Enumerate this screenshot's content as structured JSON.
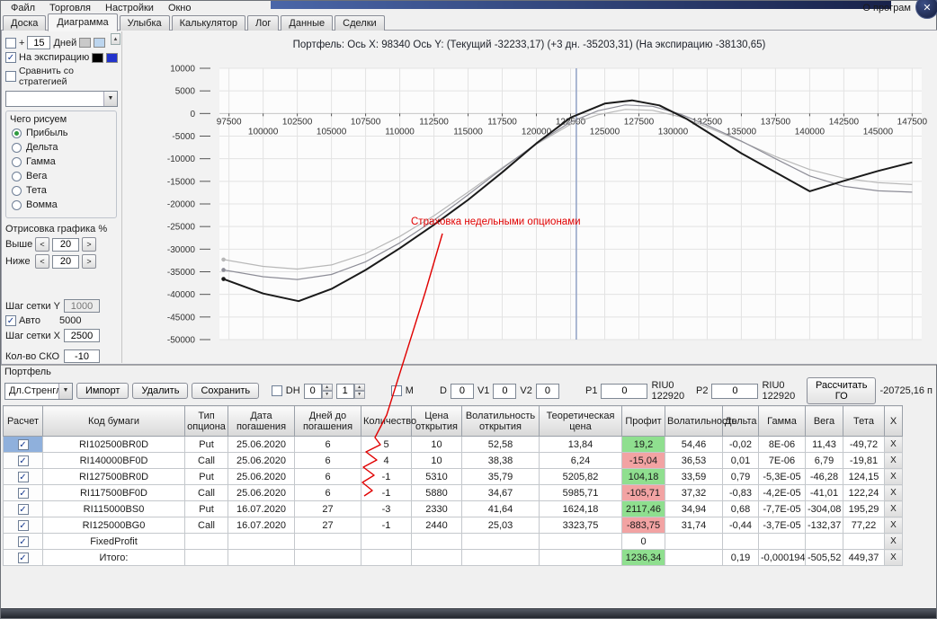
{
  "icons": {
    "check": "✓",
    "dropdown": "▼",
    "close": "✕",
    "scroll_up": "▲",
    "spin_up": "▲",
    "spin_down": "▼"
  },
  "window": {
    "about_label": "О програм"
  },
  "menubar": {
    "items": [
      "Файл",
      "Торговля",
      "Настройки",
      "Окно"
    ]
  },
  "tabs": {
    "items": [
      "Доска",
      "Диаграмма",
      "Улыбка",
      "Калькулятор",
      "Лог",
      "Данные",
      "Сделки"
    ],
    "active": "Диаграмма"
  },
  "sidebar": {
    "days_plus": "+",
    "days_value": "15",
    "days_label": "Дней",
    "legend_days_colors": [
      "#c9c9c9",
      "#bcd5ee"
    ],
    "exp_label": "На экспирацию",
    "legend_exp_colors": [
      "#000000",
      "#2233cc"
    ],
    "compare_label": "Сравнить со стратегией",
    "draw_title": "Чего рисуем",
    "draw_options": [
      "Прибыль",
      "Дельта",
      "Гамма",
      "Вега",
      "Тета",
      "Вомма"
    ],
    "draw_selected": "Прибыль",
    "render_title": "Отрисовка графика %",
    "above_label": "Выше",
    "above_value": "20",
    "below_label": "Ниже",
    "below_value": "20",
    "dec_label": "<",
    "inc_label": ">",
    "grid_y_label": "Шаг сетки Y",
    "grid_y_value": "1000",
    "auto_label": "Авто",
    "auto_extra": "5000",
    "grid_x_label": "Шаг сетки X",
    "grid_x_value": "2500",
    "sko_label": "Кол-во СКО",
    "sko_value": "-10"
  },
  "chart_data": {
    "type": "line",
    "title": "Портфель: Ось X: 98340 Ось Y:  (Текущий -32233,17)  (+3 дн. -35203,31)  (На экспирацию -38130,65)",
    "xlim": [
      96800,
      148200
    ],
    "ylim": [
      -50000,
      10000
    ],
    "x_ticks": [
      97500,
      100000,
      102500,
      105000,
      107500,
      110000,
      112500,
      115000,
      117500,
      120000,
      122500,
      125000,
      127500,
      130000,
      132500,
      135000,
      137500,
      140000,
      142500,
      145000,
      147500
    ],
    "y_ticks": [
      10000,
      5000,
      0,
      -5000,
      -10000,
      -15000,
      -20000,
      -25000,
      -30000,
      -35000,
      -40000,
      -45000,
      -50000
    ],
    "marker_x": 122920,
    "grid": true,
    "legend_position": "none",
    "series": [
      {
        "name": "Текущий",
        "color": "#b8b8b8",
        "width": 1.2,
        "points": [
          [
            97100,
            -32300
          ],
          [
            100000,
            -33800
          ],
          [
            102500,
            -34400
          ],
          [
            105000,
            -33500
          ],
          [
            107500,
            -31000
          ],
          [
            110000,
            -27200
          ],
          [
            112500,
            -22600
          ],
          [
            115000,
            -17400
          ],
          [
            117500,
            -12000
          ],
          [
            120000,
            -6800
          ],
          [
            122500,
            -2400
          ],
          [
            124500,
            -300
          ],
          [
            126500,
            900
          ],
          [
            128500,
            700
          ],
          [
            130500,
            -700
          ],
          [
            132500,
            -3000
          ],
          [
            135000,
            -6200
          ],
          [
            137500,
            -9500
          ],
          [
            140000,
            -12400
          ],
          [
            142500,
            -14300
          ],
          [
            145000,
            -15300
          ],
          [
            147500,
            -15700
          ]
        ]
      },
      {
        "name": "+3 дн.",
        "color": "#8d8d97",
        "width": 1.2,
        "points": [
          [
            97100,
            -34600
          ],
          [
            100000,
            -36100
          ],
          [
            102500,
            -36700
          ],
          [
            105000,
            -35600
          ],
          [
            107500,
            -32800
          ],
          [
            110000,
            -28600
          ],
          [
            112500,
            -23600
          ],
          [
            115000,
            -18000
          ],
          [
            117500,
            -12200
          ],
          [
            120000,
            -6600
          ],
          [
            122500,
            -1900
          ],
          [
            124500,
            600
          ],
          [
            126500,
            1900
          ],
          [
            128500,
            1600
          ],
          [
            130500,
            -100
          ],
          [
            132500,
            -2600
          ],
          [
            135000,
            -6100
          ],
          [
            137500,
            -10000
          ],
          [
            140000,
            -13800
          ],
          [
            142500,
            -16100
          ],
          [
            145000,
            -17100
          ],
          [
            147500,
            -17400
          ]
        ]
      },
      {
        "name": "На экспирацию",
        "color": "#1a1a1a",
        "width": 2,
        "points": [
          [
            97100,
            -36600
          ],
          [
            100000,
            -39800
          ],
          [
            102600,
            -41500
          ],
          [
            105000,
            -38800
          ],
          [
            107500,
            -34600
          ],
          [
            110000,
            -29800
          ],
          [
            112500,
            -24600
          ],
          [
            115000,
            -19100
          ],
          [
            117500,
            -13000
          ],
          [
            120000,
            -6600
          ],
          [
            122500,
            -900
          ],
          [
            125000,
            2200
          ],
          [
            127000,
            2900
          ],
          [
            129000,
            1800
          ],
          [
            131000,
            -1200
          ],
          [
            133000,
            -5000
          ],
          [
            135000,
            -8800
          ],
          [
            137500,
            -13000
          ],
          [
            140000,
            -17200
          ],
          [
            142500,
            -14900
          ],
          [
            145000,
            -12700
          ],
          [
            147500,
            -10800
          ]
        ]
      }
    ]
  },
  "annotation": {
    "text": "Страховка недельными опционами",
    "color": "#e00000",
    "text_x": 457,
    "text_y": 250,
    "path": [
      [
        492,
        260
      ],
      [
        473,
        325
      ],
      [
        452,
        392
      ],
      [
        430,
        462
      ],
      [
        417,
        487
      ],
      [
        423,
        495
      ],
      [
        407,
        503
      ],
      [
        419,
        512
      ],
      [
        404,
        520
      ],
      [
        416,
        529
      ],
      [
        403,
        537
      ],
      [
        414,
        546
      ],
      [
        405,
        552
      ]
    ]
  },
  "portfolio": {
    "section_label": "Портфель",
    "strategy_value": "Дл.Стренгл-П",
    "import_label": "Импорт",
    "delete_label": "Удалить",
    "save_label": "Сохранить",
    "dh_label": "DH",
    "dh_spin1": "0",
    "dh_spin2": "1",
    "m_label": "M",
    "d_label": "D",
    "d_value": "0",
    "v1_label": "V1",
    "v1_value": "0",
    "v2_label": "V2",
    "v2_value": "0",
    "p1_label": "P1",
    "p1_value": "0",
    "riu_left": "RIU0 122920",
    "p2_label": "P2",
    "p2_value": "0",
    "riu_right": "RIU0 122920",
    "calc_label": "Рассчитать ГО",
    "margin_value": "-20725,16 п"
  },
  "table": {
    "delete_label": "X",
    "headers": [
      "Расчет",
      "Код бумаги",
      "Тип\nопциона",
      "Дата\nпогашения",
      "Дней до\nпогашения",
      "Количество",
      "Цена\nоткрытия",
      "Волатильность\nоткрытия",
      "Теоретическая\nцена",
      "Профит",
      "Волатильность",
      "Дельта",
      "Гамма",
      "Вега",
      "Тета",
      "X"
    ],
    "rows": [
      {
        "checked": true,
        "selected": true,
        "code": "RI102500BR0D",
        "type": "Put",
        "date": "25.06.2020",
        "days": "6",
        "qty": "5",
        "price": "10",
        "vol_open": "52,58",
        "theo": "13,84",
        "profit": "19,2",
        "profit_color": "pos",
        "vol": "54,46",
        "delta": "-0,02",
        "gamma": "8E-06",
        "vega": "11,43",
        "theta": "-49,72"
      },
      {
        "checked": true,
        "code": "RI140000BF0D",
        "type": "Call",
        "date": "25.06.2020",
        "days": "6",
        "qty": "4",
        "price": "10",
        "vol_open": "38,38",
        "theo": "6,24",
        "profit": "-15,04",
        "profit_color": "neg",
        "vol": "36,53",
        "delta": "0,01",
        "gamma": "7E-06",
        "vega": "6,79",
        "theta": "-19,81"
      },
      {
        "checked": true,
        "code": "RI127500BR0D",
        "type": "Put",
        "date": "25.06.2020",
        "days": "6",
        "qty": "-1",
        "price": "5310",
        "vol_open": "35,79",
        "theo": "5205,82",
        "profit": "104,18",
        "profit_color": "pos",
        "vol": "33,59",
        "delta": "0,79",
        "gamma": "-5,3E-05",
        "vega": "-46,28",
        "theta": "124,15"
      },
      {
        "checked": true,
        "code": "RI117500BF0D",
        "type": "Call",
        "date": "25.06.2020",
        "days": "6",
        "qty": "-1",
        "price": "5880",
        "vol_open": "34,67",
        "theo": "5985,71",
        "profit": "-105,71",
        "profit_color": "neg",
        "vol": "37,32",
        "delta": "-0,83",
        "gamma": "-4,2E-05",
        "vega": "-41,01",
        "theta": "122,24"
      },
      {
        "checked": true,
        "code": "RI115000BS0",
        "type": "Put",
        "date": "16.07.2020",
        "days": "27",
        "qty": "-3",
        "price": "2330",
        "vol_open": "41,64",
        "theo": "1624,18",
        "profit": "2117,46",
        "profit_color": "pos",
        "vol": "34,94",
        "delta": "0,68",
        "gamma": "-7,7E-05",
        "vega": "-304,08",
        "theta": "195,29"
      },
      {
        "checked": true,
        "code": "RI125000BG0",
        "type": "Call",
        "date": "16.07.2020",
        "days": "27",
        "qty": "-1",
        "price": "2440",
        "vol_open": "25,03",
        "theo": "3323,75",
        "profit": "-883,75",
        "profit_color": "neg",
        "vol": "31,74",
        "delta": "-0,44",
        "gamma": "-3,7E-05",
        "vega": "-132,37",
        "theta": "77,22"
      },
      {
        "checked": true,
        "code": "FixedProfit",
        "profit": "0"
      },
      {
        "checked": true,
        "code": "Итого:",
        "profit": "1236,34",
        "profit_color": "pos",
        "delta": "0,19",
        "gamma": "-0,000194",
        "vega": "-505,52",
        "theta": "449,37"
      }
    ]
  }
}
